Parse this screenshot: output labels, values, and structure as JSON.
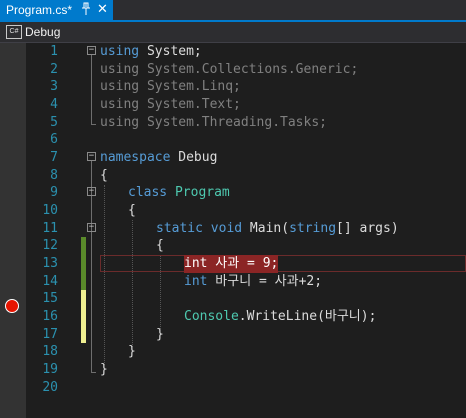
{
  "tab": {
    "title": "Program.cs*",
    "pin_icon": "pin-icon",
    "close_label": "✕"
  },
  "navbar": {
    "badge": "C#",
    "label": "Debug"
  },
  "line_numbers": [
    "1",
    "2",
    "3",
    "4",
    "5",
    "6",
    "7",
    "8",
    "9",
    "10",
    "11",
    "12",
    "13",
    "14",
    "15",
    "16",
    "17",
    "18",
    "19",
    "20"
  ],
  "code": {
    "l1_kw": "using",
    "l1_rest": " System;",
    "l2_kw": "using",
    "l2_rest": " System.Collections.Generic;",
    "l3_kw": "using",
    "l3_rest": " System.Linq;",
    "l4_kw": "using",
    "l4_rest": " System.Text;",
    "l5_kw": "using",
    "l5_rest": " System.Threading.Tasks;",
    "l7_kw": "namespace",
    "l7_rest": " Debug",
    "l8": "{",
    "l9_kw": "class",
    "l9_type": " Program",
    "l10": "{",
    "l11_kw1": "static",
    "l11_kw2": " void",
    "l11_a": " Main(",
    "l11_kw3": "string",
    "l11_b": "[] args)",
    "l12": "{",
    "l13": "int 사과 = 9;",
    "l14_kw": "int",
    "l14_rest": " 바구니 = 사과+2;",
    "l16_type": "Console",
    "l16_rest": ".WriteLine(바구니);",
    "l17": "}",
    "l18": "}",
    "l19": "}"
  },
  "colors": {
    "keyword": "#569cd6",
    "type": "#4ec9b0",
    "plain": "#dcdcdc",
    "line_number": "#2b91af",
    "breakpoint": "#e51400",
    "breakpoint_highlight": "#8b2525",
    "change_saved": "#5a8a2a",
    "change_unsaved": "#efef91",
    "accent": "#007acc"
  }
}
